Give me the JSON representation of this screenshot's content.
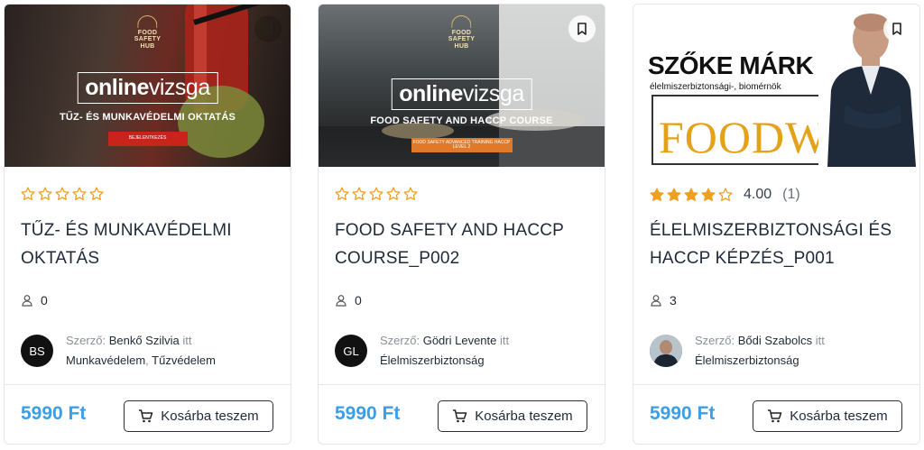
{
  "cards": [
    {
      "thumb": {
        "crest": [
          "FOOD",
          "SAFETY",
          "HUB"
        ],
        "logo_main": "online",
        "logo_thin": "vizsga",
        "subtitle": "TŰZ- ÉS MUNKAVÉDELMI OKTATÁS",
        "button": "BEJELENTKEZÉS",
        "button_color": "#c9241c"
      },
      "rating": {
        "stars_filled": 0,
        "value": "",
        "count": ""
      },
      "title": "TŰZ- ÉS MUNKAVÉDELMI OKTATÁS",
      "students": "0",
      "author": {
        "initials": "BS",
        "prefix": "Szerző:",
        "name": "Benkő Szilvia",
        "in": "itt",
        "categories": [
          "Munkavédelem",
          "Tűzvédelem"
        ]
      },
      "price": "5990 Ft",
      "cart_label": "Kosárba teszem"
    },
    {
      "thumb": {
        "crest": [
          "FOOD",
          "SAFETY",
          "HUB"
        ],
        "logo_main": "online",
        "logo_thin": "vizsga",
        "subtitle": "FOOD SAFETY AND HACCP COURSE",
        "button": "FOOD SAFETY ADVANCED TRAINING HACCP LEVEL 2",
        "button_color": "#e07a2a"
      },
      "rating": {
        "stars_filled": 0,
        "value": "",
        "count": ""
      },
      "title": "FOOD SAFETY AND HACCP COURSE_P002",
      "students": "0",
      "author": {
        "initials": "GL",
        "prefix": "Szerző:",
        "name": "Gödri Levente",
        "in": "itt",
        "categories": [
          "Élelmiszerbiztonság"
        ]
      },
      "price": "5990 Ft",
      "cart_label": "Kosárba teszem"
    },
    {
      "thumb": {
        "name": "SZŐKE MÁRK",
        "role": "élelmiszerbiztonsági-, biomérnök",
        "brand": "FOODWILL",
        "brand_color": "#e3a21a"
      },
      "rating": {
        "stars_filled": 4,
        "value": "4.00",
        "count": "(1)"
      },
      "title": "ÉLELMISZERBIZTONSÁGI ÉS HACCP KÉPZÉS_P001",
      "students": "3",
      "author": {
        "initials": "",
        "prefix": "Szerző:",
        "name": "Bődi Szabolcs",
        "in": "itt",
        "categories": [
          "Élelmiszerbiztonság"
        ]
      },
      "price": "5990 Ft",
      "cart_label": "Kosárba teszem"
    }
  ],
  "colors": {
    "star": "#f0a020",
    "price": "#3b9ee9",
    "border": "#e3e6ea"
  },
  "icons": {
    "bookmark": "bookmark-icon",
    "star": "star-icon",
    "student": "user-icon",
    "cart": "cart-icon"
  }
}
